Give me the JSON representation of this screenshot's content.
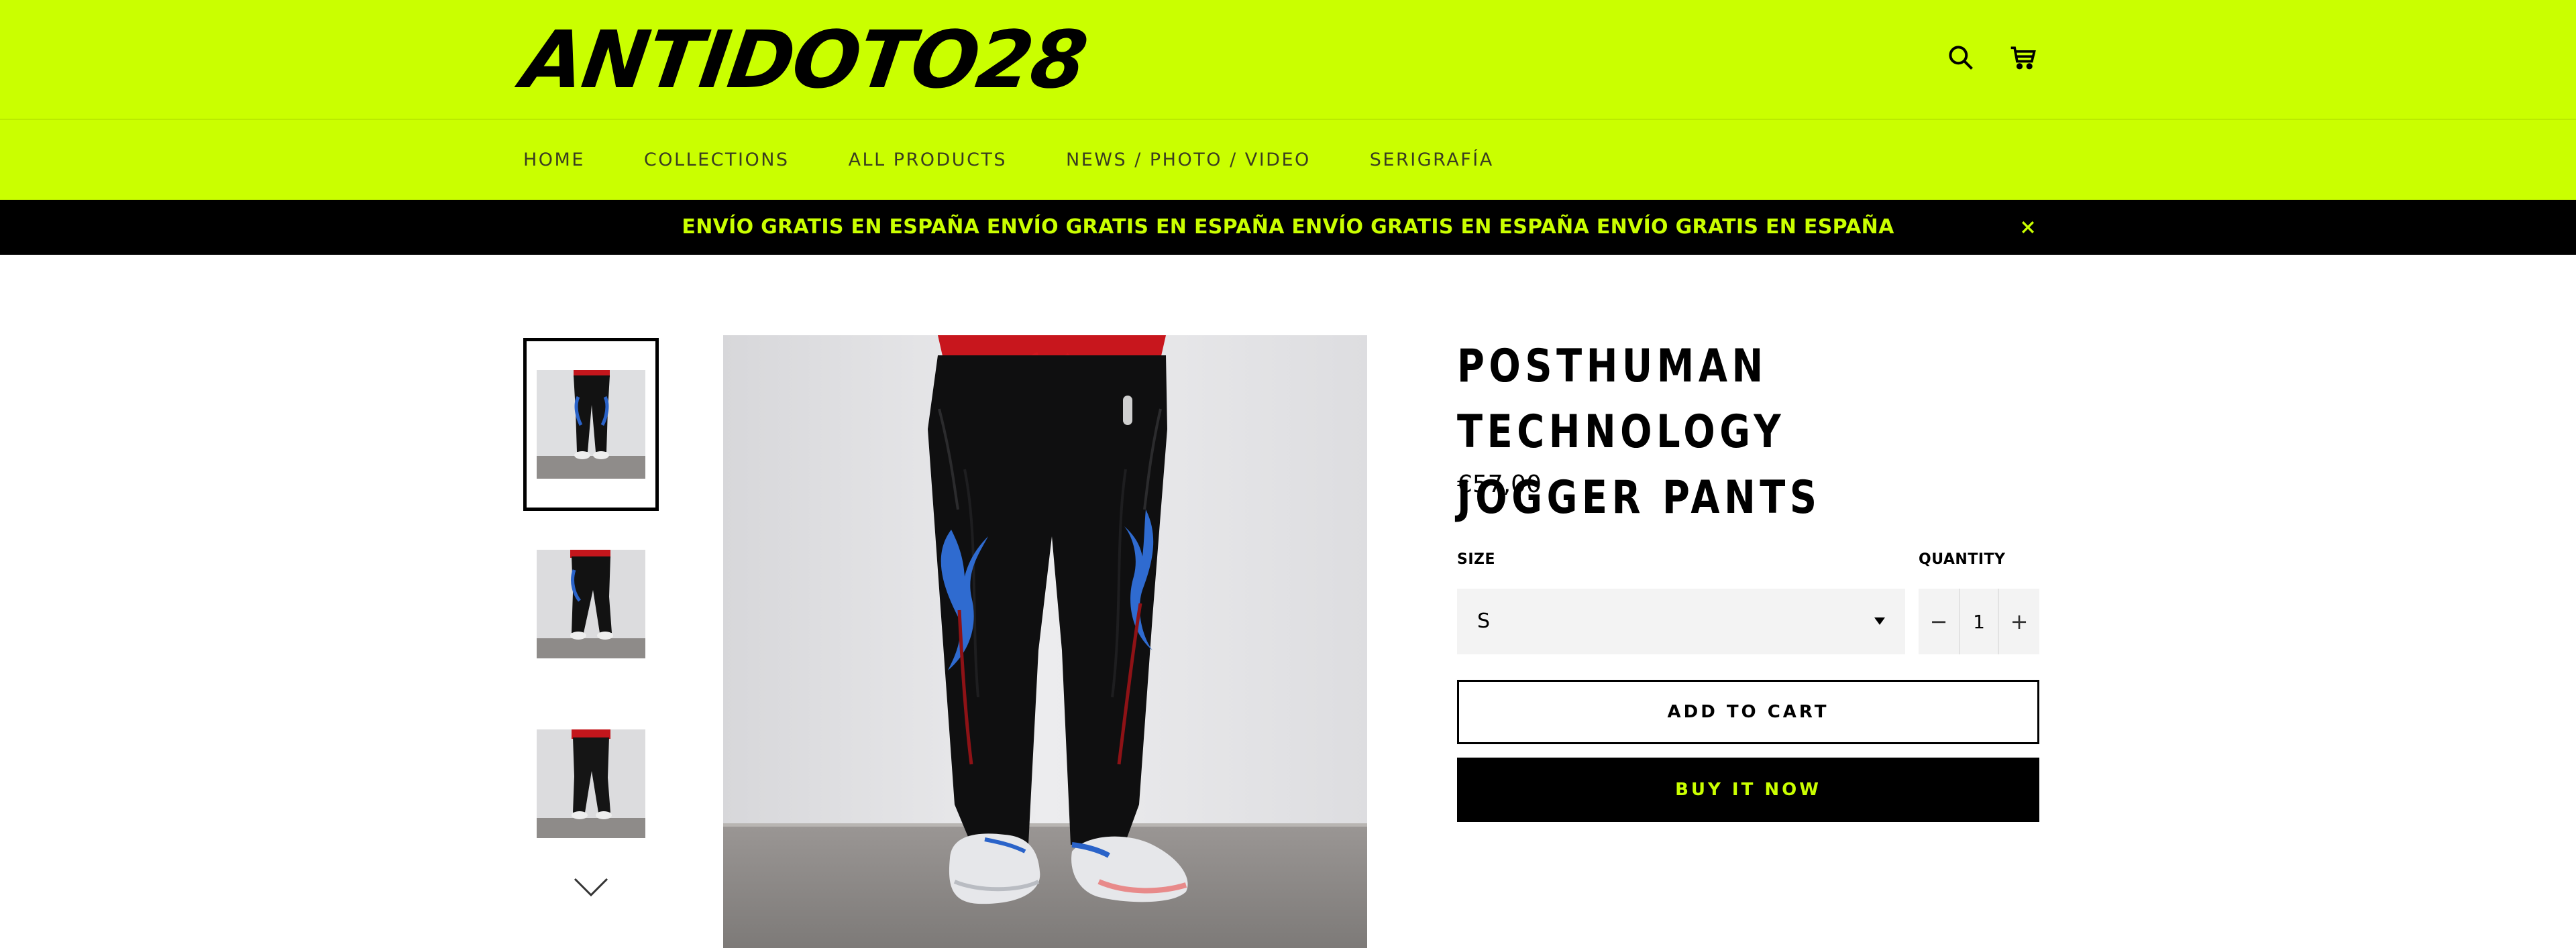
{
  "brand": {
    "logo_text": "ANTIDOTO28",
    "accent": "#caff00"
  },
  "header": {
    "icons": [
      "search-icon",
      "cart-icon"
    ]
  },
  "nav": {
    "items": [
      {
        "label": "HOME"
      },
      {
        "label": "COLLECTIONS"
      },
      {
        "label": "ALL PRODUCTS"
      },
      {
        "label": "NEWS / PHOTO / VIDEO"
      },
      {
        "label": "SERIGRAFÍA"
      }
    ]
  },
  "announcement": {
    "text": "ENVÍO GRATIS EN ESPAÑA ENVÍO GRATIS EN ESPAÑA ENVÍO GRATIS EN ESPAÑA ENVÍO GRATIS EN ESPAÑA",
    "background": "#000000",
    "color": "#caff00"
  },
  "gallery": {
    "thumbnails": [
      {
        "label": "Posthuman Technology Jogger Pants front",
        "active": true
      },
      {
        "label": "Posthuman Technology Jogger Pants side",
        "active": false
      },
      {
        "label": "Posthuman Technology Jogger Pants back",
        "active": false
      }
    ],
    "more_icon": "chevron-down-icon"
  },
  "product": {
    "title_line1": "POSTHUMAN TECHNOLOGY",
    "title_line2": "JOGGER PANTS",
    "price": "€57,00",
    "size_label": "SIZE",
    "size_value": "S",
    "quantity_label": "QUANTITY",
    "quantity_value": "1",
    "qty_minus": "−",
    "qty_plus": "+",
    "add_to_cart": "ADD TO CART",
    "buy_now": "BUY IT NOW"
  }
}
